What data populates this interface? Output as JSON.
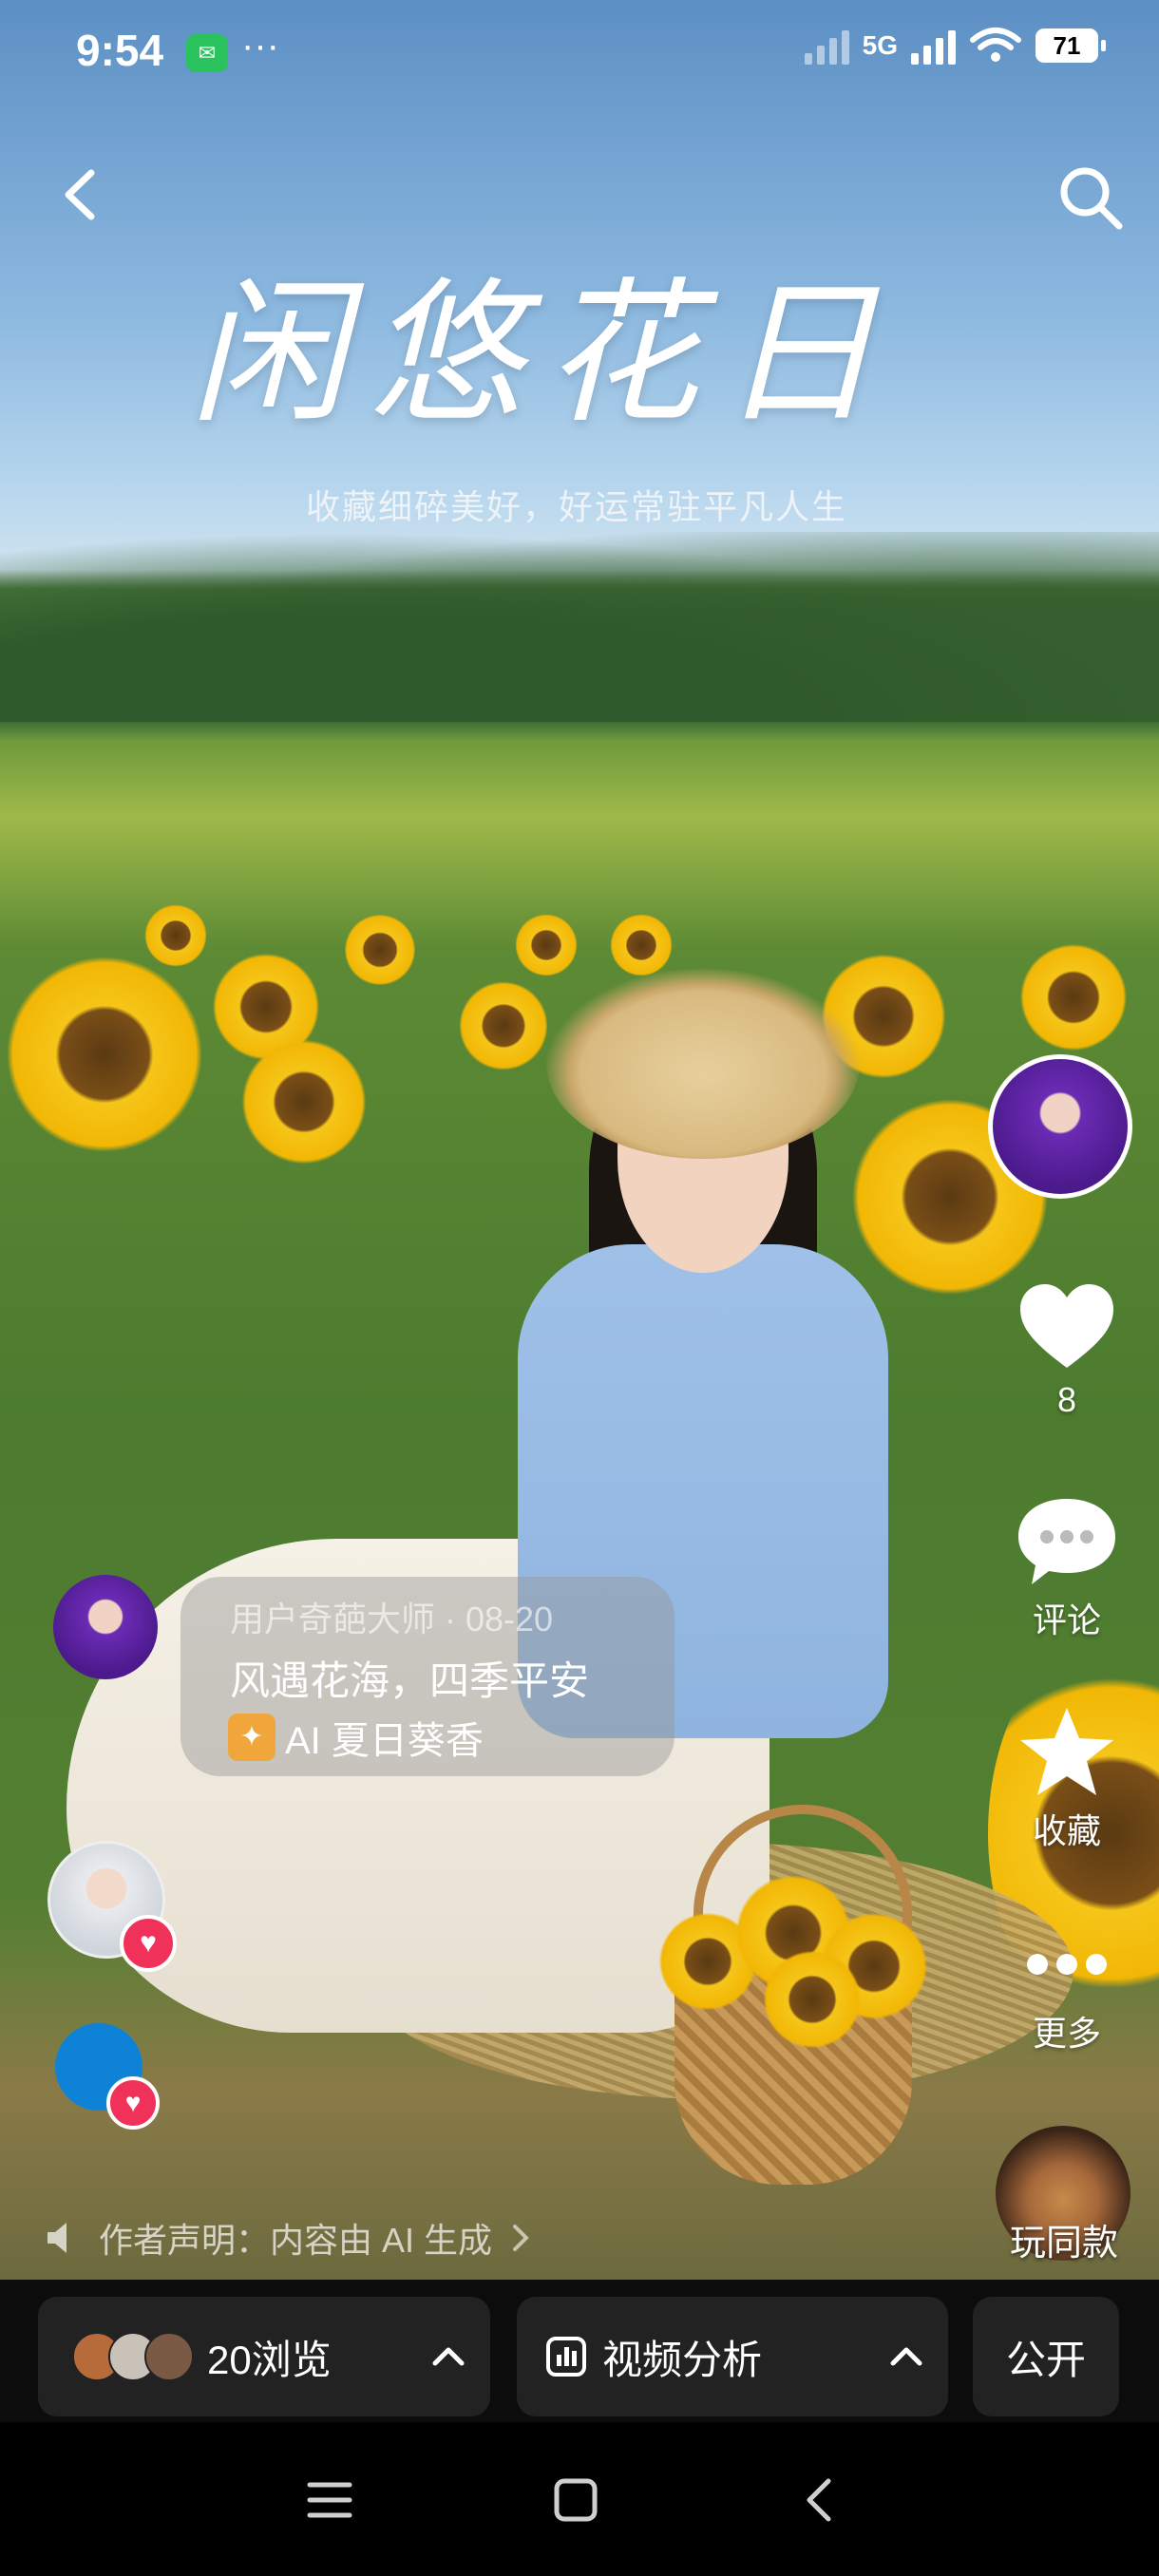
{
  "status_bar": {
    "time": "9:54",
    "wechat_icon": "wechat-icon",
    "more": "···",
    "network": "5G",
    "battery": "71"
  },
  "poster": {
    "title": "闲悠花日",
    "subtitle": "收藏细碎美好，好运常驻平凡人生"
  },
  "rail": {
    "like_count": "8",
    "comment_label": "评论",
    "favorite_label": "收藏",
    "more_label": "更多",
    "play_same_label": "玩同款"
  },
  "caption": {
    "meta": "用户奇葩大师 · 08-20",
    "text": "风遇花海，四季平安",
    "tag": "AI 夏日葵香"
  },
  "declaration": "作者声明：内容由 AI 生成",
  "bottom_bar": {
    "views": "20浏览",
    "analysis": "视频分析",
    "visibility": "公开"
  },
  "colors": {
    "heart_badge": "#f0325a",
    "tag_icon": "#f0a63a",
    "pill_bg": "#222222"
  }
}
